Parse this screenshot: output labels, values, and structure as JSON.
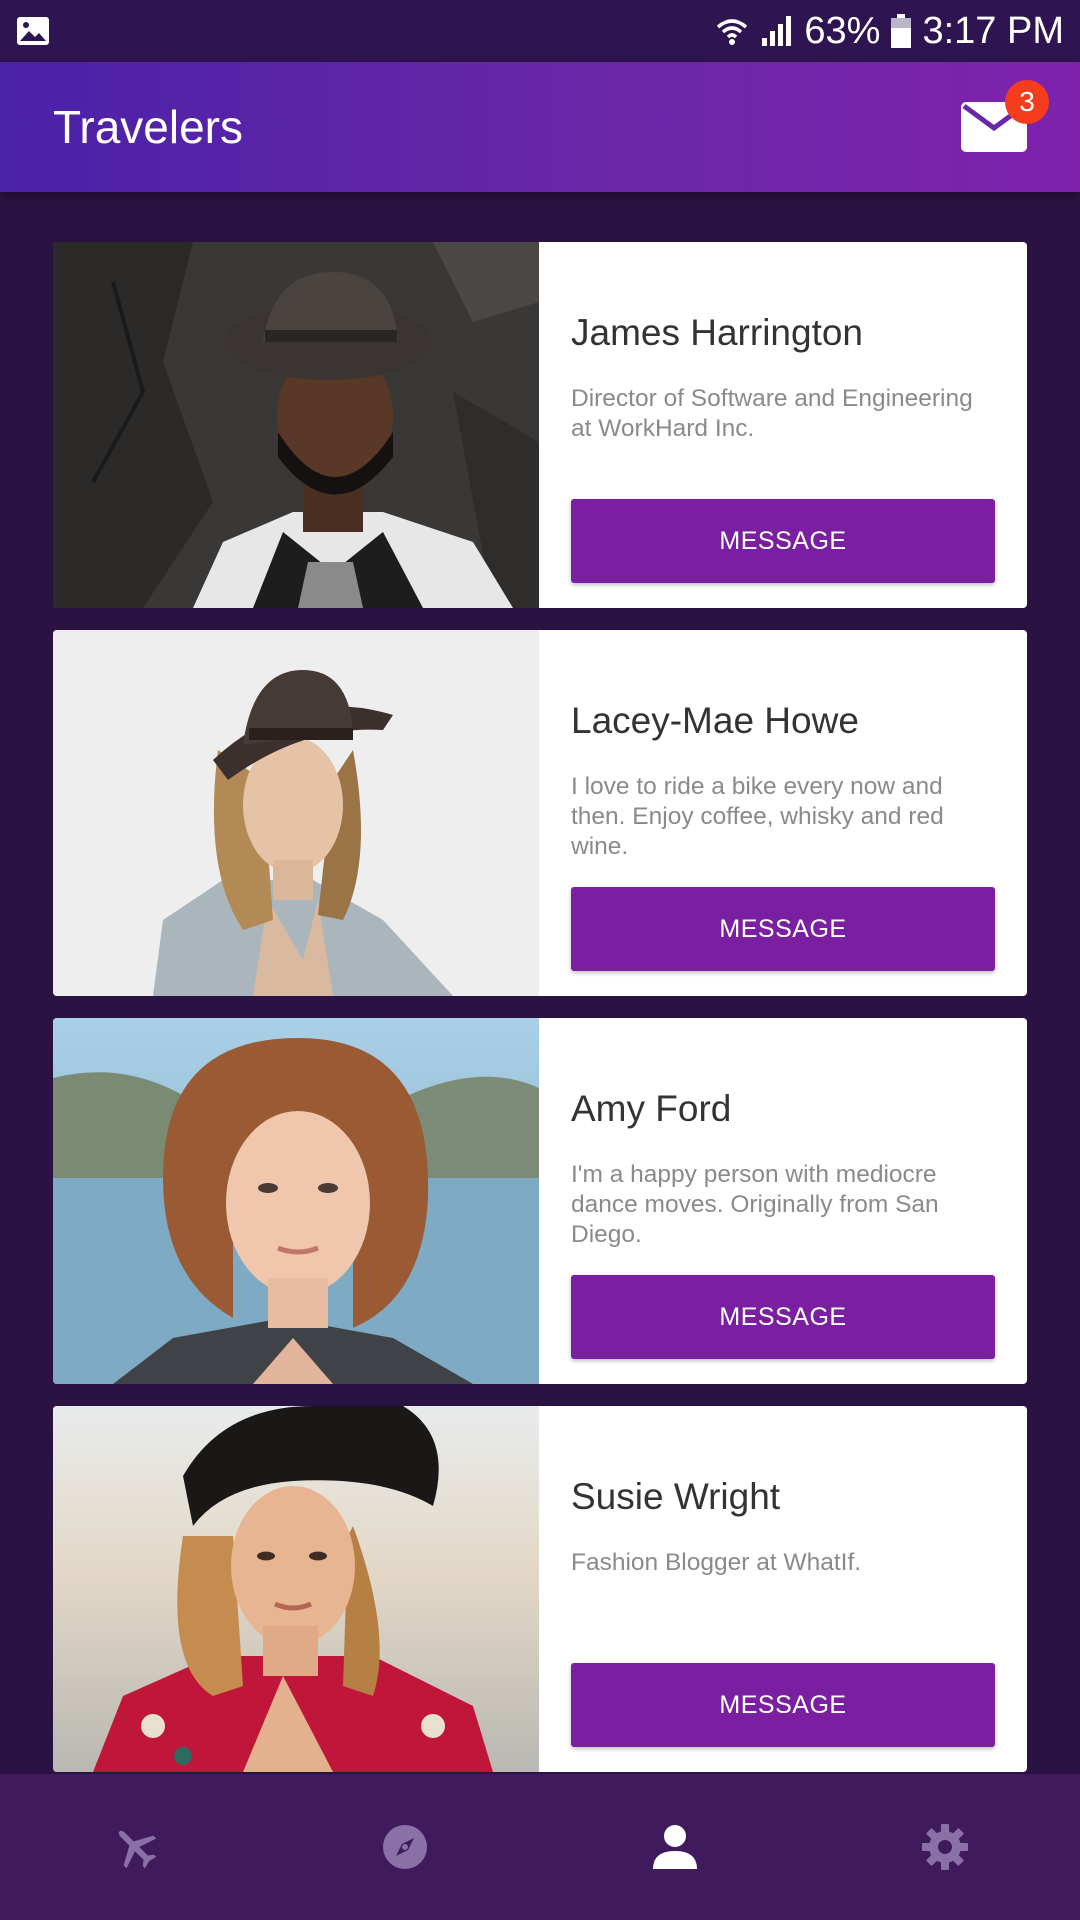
{
  "status_bar": {
    "battery": "63%",
    "time": "3:17 PM",
    "icons": [
      "image-icon",
      "wifi-icon",
      "signal-icon",
      "battery-icon"
    ]
  },
  "app_bar": {
    "title": "Travelers",
    "mail_badge_count": "3"
  },
  "travelers": [
    {
      "name": "James Harrington",
      "bio": "Director of Software and Engineering at WorkHard Inc.",
      "button": "MESSAGE"
    },
    {
      "name": "Lacey-Mae Howe",
      "bio": "I love to ride a bike every now and then. Enjoy coffee, whisky and red wine.",
      "button": "MESSAGE"
    },
    {
      "name": "Amy Ford",
      "bio": "I'm a happy person with mediocre dance moves. Originally from San Diego.",
      "button": "MESSAGE"
    },
    {
      "name": "Susie Wright",
      "bio": "Fashion Blogger at WhatIf.",
      "button": "MESSAGE"
    }
  ],
  "bottom_nav": {
    "items": [
      "airplane-icon",
      "compass-icon",
      "person-icon",
      "gear-icon"
    ],
    "active": "person-icon"
  },
  "colors": {
    "accent": "#7b1fa2",
    "badge": "#f53d1d",
    "background": "#2a1242",
    "nav_background": "#3f1a5c"
  }
}
